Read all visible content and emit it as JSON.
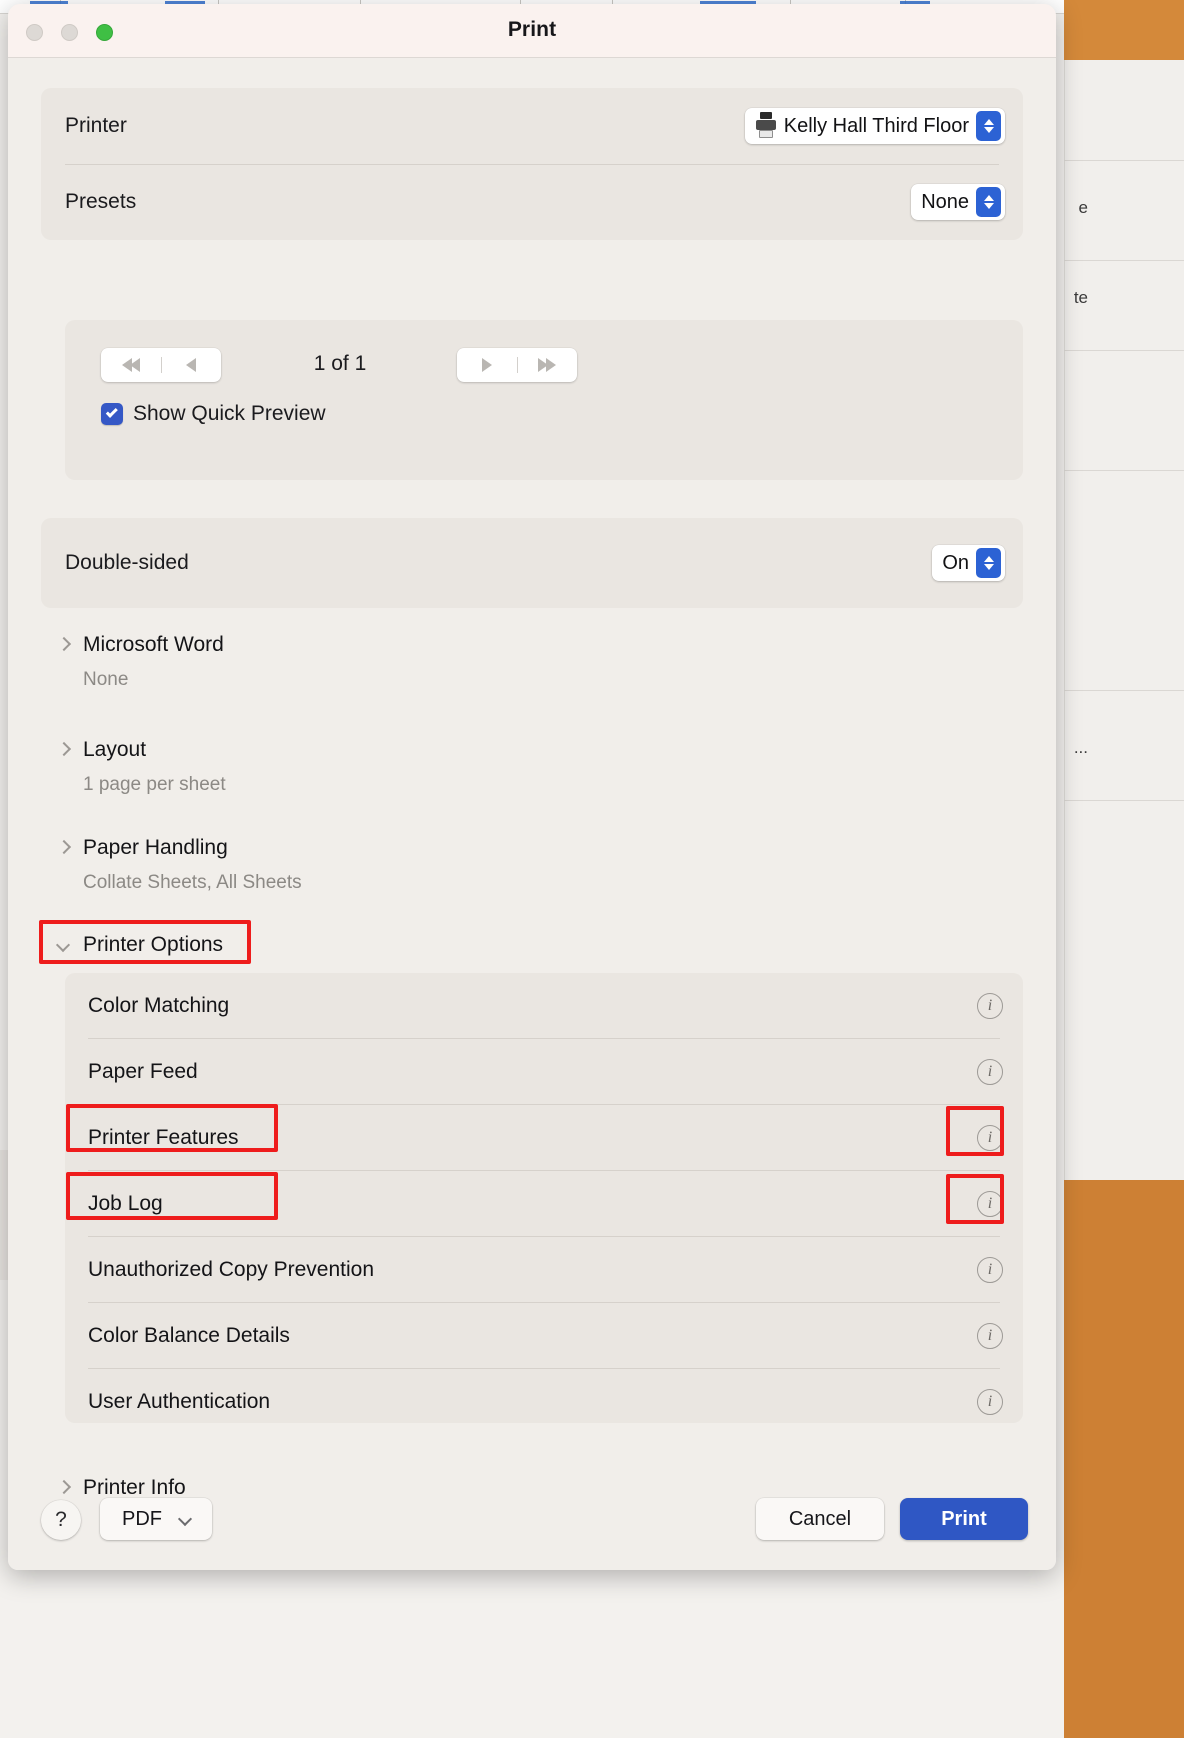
{
  "window": {
    "title": "Print",
    "traffic_lights": [
      "close-button",
      "minimize-button",
      "zoom-button"
    ],
    "accent_blue": "#2c62d4",
    "annotation_red": "#ee1c1c"
  },
  "printer_section": {
    "printer_label": "Printer",
    "printer_value": "Kelly Hall Third Floor",
    "presets_label": "Presets",
    "presets_value": "None"
  },
  "preview_section": {
    "page_count": "1 of 1",
    "quick_preview_label": "Show Quick Preview",
    "quick_preview_checked": true,
    "nav_first": "first-page",
    "nav_prev": "previous-page",
    "nav_next": "next-page",
    "nav_last": "last-page"
  },
  "double_sided": {
    "label": "Double-sided",
    "value": "On"
  },
  "sections": [
    {
      "title": "Microsoft Word",
      "subtitle": "None",
      "expanded": false
    },
    {
      "title": "Layout",
      "subtitle": "1 page per sheet",
      "expanded": false
    },
    {
      "title": "Paper Handling",
      "subtitle": "Collate Sheets, All Sheets",
      "expanded": false
    },
    {
      "title": "Printer Options",
      "subtitle": "",
      "expanded": true
    },
    {
      "title": "Printer Info",
      "subtitle": "",
      "expanded": false
    }
  ],
  "printer_options": [
    {
      "label": "Color Matching",
      "info": "i",
      "highlighted": false,
      "info_highlighted": false
    },
    {
      "label": "Paper Feed",
      "info": "i",
      "highlighted": false,
      "info_highlighted": false
    },
    {
      "label": "Printer Features",
      "info": "i",
      "highlighted": true,
      "info_highlighted": true
    },
    {
      "label": "Job Log",
      "info": "i",
      "highlighted": true,
      "info_highlighted": true
    },
    {
      "label": "Unauthorized Copy Prevention",
      "info": "i",
      "highlighted": false,
      "info_highlighted": false
    },
    {
      "label": "Color Balance Details",
      "info": "i",
      "highlighted": false,
      "info_highlighted": false
    },
    {
      "label": "User Authentication",
      "info": "i",
      "highlighted": false,
      "info_highlighted": false
    }
  ],
  "bottom_bar": {
    "help_label": "?",
    "pdf_label": "PDF",
    "cancel_label": "Cancel",
    "print_label": "Print"
  },
  "backdrop": {
    "side_text_1": "e",
    "side_text_2": "te",
    "side_text_3": "..."
  }
}
